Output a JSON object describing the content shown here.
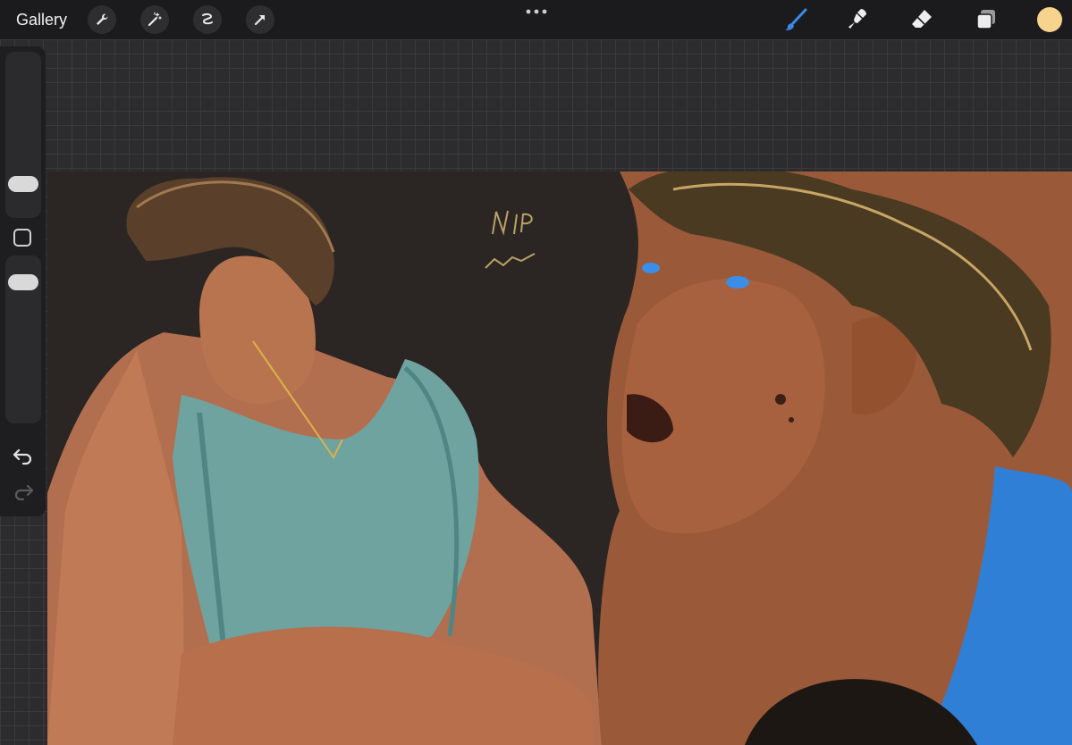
{
  "toolbar": {
    "gallery_label": "Gallery",
    "left_tools": [
      "wrench-icon",
      "magic-wand-icon",
      "selection-icon",
      "transform-arrow-icon"
    ],
    "more_icon": "more-dots-icon",
    "right_tools": [
      "brush-icon",
      "smudge-icon",
      "eraser-icon",
      "layers-icon"
    ],
    "active_tool": "brush-icon",
    "accent_color": "#3a8be8",
    "current_color": "#f7d38e"
  },
  "sidebar": {
    "brush_size_icon": "slider-knob",
    "modify_icon": "square-outline-icon",
    "opacity_icon": "slider-knob",
    "undo_icon": "undo-icon",
    "redo_icon": "redo-icon"
  },
  "canvas": {
    "background_color": "#2b2624",
    "artwork": "painting-icon"
  }
}
